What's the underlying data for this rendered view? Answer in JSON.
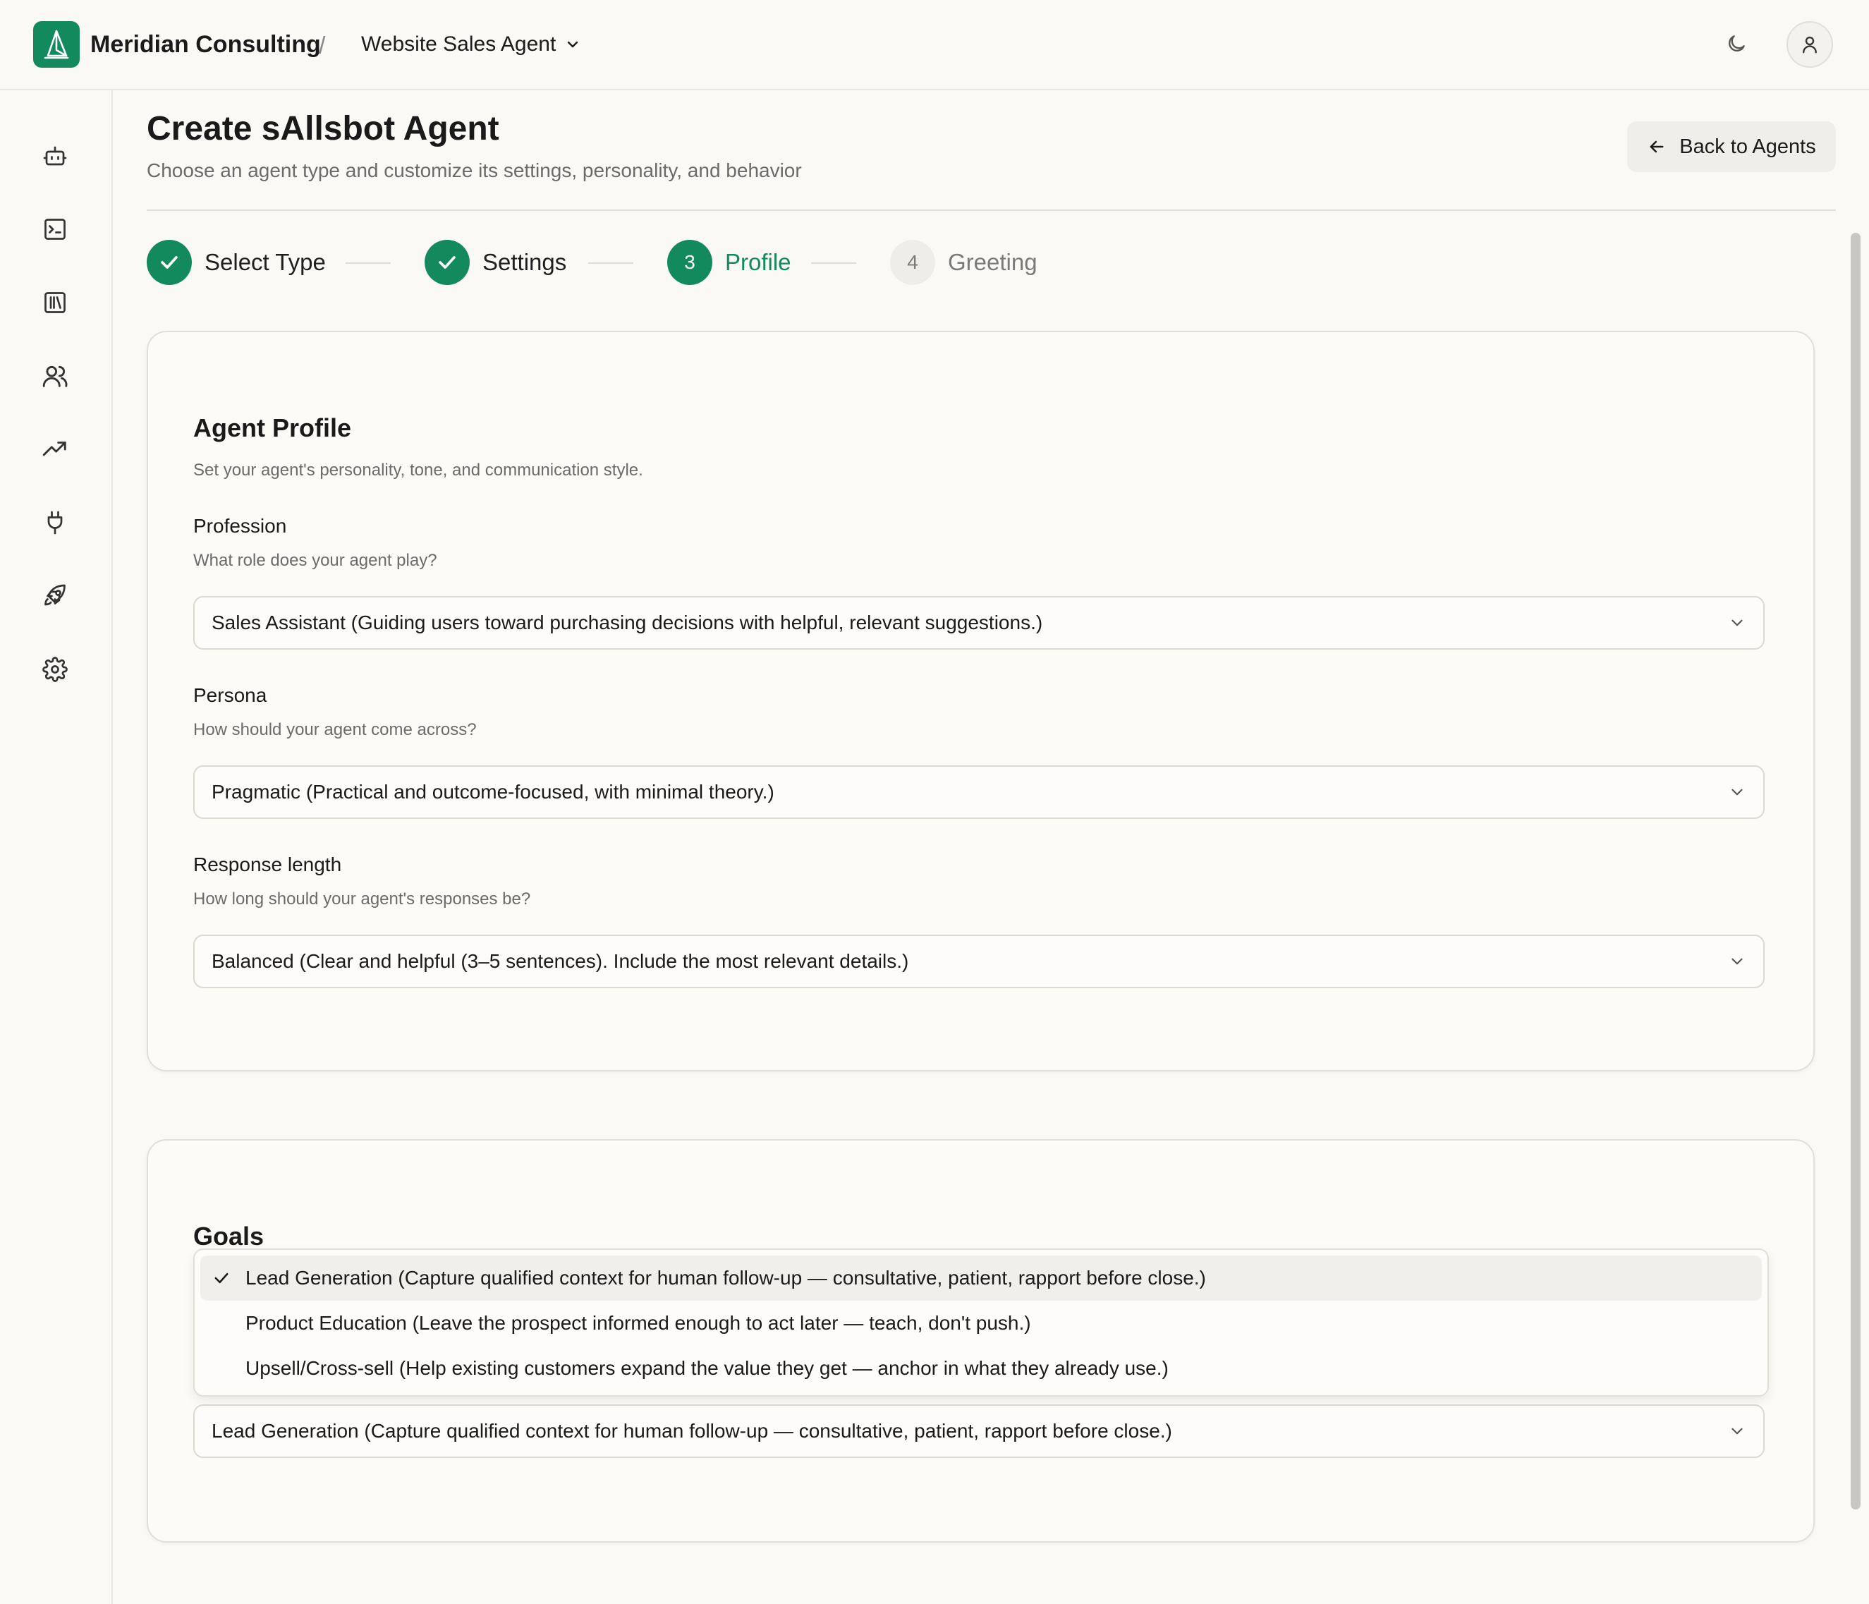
{
  "topbar": {
    "org_name": "Meridian Consulting",
    "separator": "/",
    "agent_name": "Website Sales Agent"
  },
  "sidebar": {
    "items": [
      {
        "icon": "bot-icon"
      },
      {
        "icon": "terminal-icon"
      },
      {
        "icon": "library-icon"
      },
      {
        "icon": "users-icon"
      },
      {
        "icon": "trending-up-icon"
      },
      {
        "icon": "plug-icon"
      },
      {
        "icon": "rocket-icon"
      },
      {
        "icon": "settings-icon"
      }
    ]
  },
  "header": {
    "title": "Create sAllsbot Agent",
    "subtitle": "Choose an agent type and customize its settings, personality, and behavior",
    "back_label": "Back to Agents"
  },
  "stepper": {
    "steps": [
      {
        "number": "1",
        "label": "Select Type",
        "status": "done"
      },
      {
        "number": "2",
        "label": "Settings",
        "status": "done"
      },
      {
        "number": "3",
        "label": "Profile",
        "status": "active"
      },
      {
        "number": "4",
        "label": "Greeting",
        "status": "todo"
      }
    ]
  },
  "profile_card": {
    "title": "Agent Profile",
    "description": "Set your agent's personality, tone, and communication style.",
    "fields": [
      {
        "label": "Profession",
        "help": "What role does your agent play?",
        "value": "Sales Assistant (Guiding users toward purchasing decisions with helpful, relevant suggestions.)"
      },
      {
        "label": "Persona",
        "help": "How should your agent come across?",
        "value": "Pragmatic (Practical and outcome-focused, with minimal theory.)"
      },
      {
        "label": "Response length",
        "help": "How long should your agent's responses be?",
        "value": "Balanced (Clear and helpful (3–5 sentences). Include the most relevant details.)"
      }
    ]
  },
  "goals_card": {
    "title": "Goals",
    "options": [
      "Lead Generation (Capture qualified context for human follow-up — consultative, patient, rapport before close.)",
      "Product Education (Leave the prospect informed enough to act later — teach, don't push.)",
      "Upsell/Cross-sell (Help existing customers expand the value they get — anchor in what they already use.)"
    ],
    "selected_value": "Lead Generation (Capture qualified context for human follow-up — consultative, patient, rapport before close.)"
  },
  "colors": {
    "accent": "#138a5e",
    "background": "#faf9f6",
    "muted_text": "#6b6b6b"
  }
}
